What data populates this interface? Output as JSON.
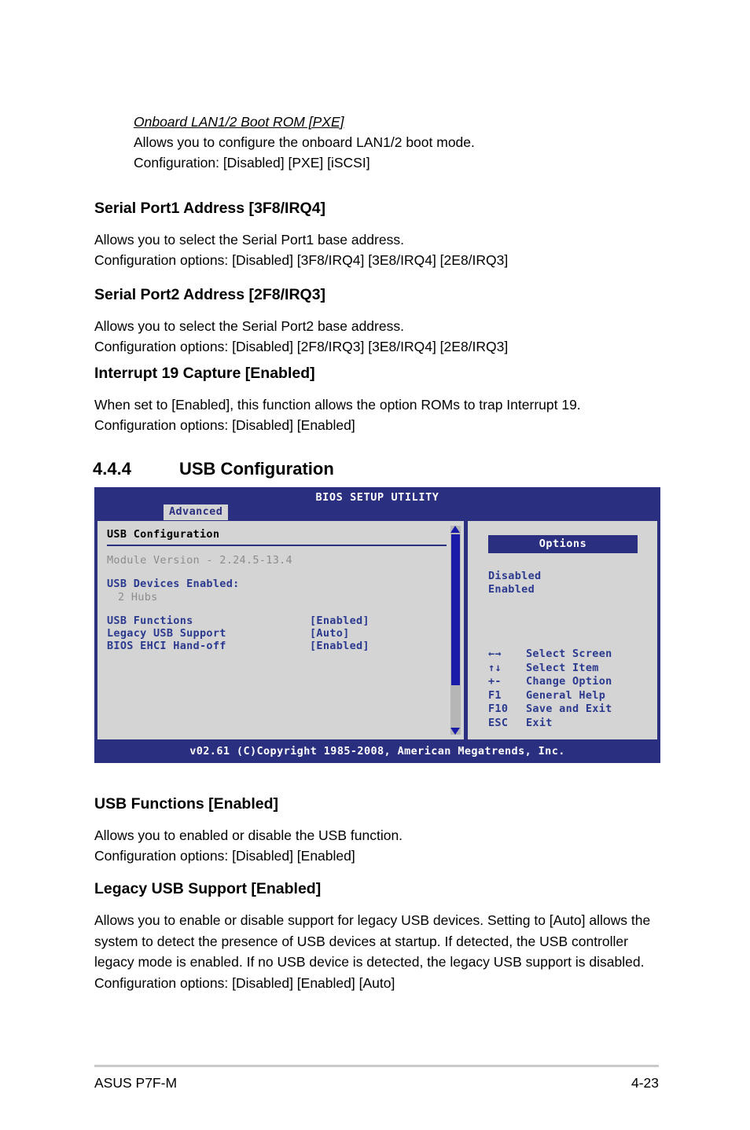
{
  "colors": {
    "bios_blue": "#2b2f80",
    "bios_panel_gray": "#d4d4d4",
    "bios_text_blue": "#2b3a8f",
    "bios_dim_gray": "#8c8c8c",
    "scrollbar_blue": "#1a1aa8"
  },
  "sections": {
    "onboard_lan": {
      "heading": "Onboard LAN1/2 Boot ROM [PXE]",
      "line1": "Allows you to configure the onboard LAN1/2 boot mode.",
      "line2": "Configuration: [Disabled] [PXE] [iSCSI]"
    },
    "serial_port1": {
      "heading": "Serial Port1 Address [3F8/IRQ4]",
      "line1": "Allows you to select the Serial Port1 base address.",
      "line2": "Configuration options: [Disabled] [3F8/IRQ4] [3E8/IRQ4] [2E8/IRQ3]"
    },
    "serial_port2": {
      "heading": "Serial Port2 Address [2F8/IRQ3]",
      "line1": "Allows you to select the Serial Port2 base address.",
      "line2": "Configuration options: [Disabled] [2F8/IRQ3] [3E8/IRQ4] [2E8/IRQ3]"
    },
    "interrupt19": {
      "heading": "Interrupt 19 Capture [Enabled]",
      "line1": "When set to [Enabled], this function allows the option ROMs to trap Interrupt 19.",
      "line2": "Configuration options: [Disabled] [Enabled]"
    },
    "usb_functions": {
      "heading": "USB Functions [Enabled]",
      "line1": "Allows you to enabled or disable the USB function.",
      "line2": "Configuration options: [Disabled] [Enabled]"
    },
    "legacy_usb": {
      "heading": "Legacy USB Support [Enabled]",
      "paragraph": "Allows you to enable or disable support for legacy USB devices. Setting to [Auto] allows the system to detect the presence of USB devices at startup. If detected, the USB controller legacy mode is enabled. If no USB device is detected, the legacy USB support is disabled. Configuration options: [Disabled] [Enabled] [Auto]"
    }
  },
  "section_heading": {
    "number": "4.4.4",
    "title": "USB Configuration"
  },
  "bios": {
    "title": "BIOS SETUP UTILITY",
    "tab": "Advanced",
    "panel_title": "USB Configuration",
    "module_version": "Module Version - 2.24.5-13.4",
    "devices_label": "USB Devices Enabled:",
    "devices_value": "2 Hubs",
    "settings": [
      {
        "label": "USB Functions",
        "value": "[Enabled]"
      },
      {
        "label": "Legacy USB Support",
        "value": "[Auto]"
      },
      {
        "label": "BIOS EHCI Hand-off",
        "value": "[Enabled]"
      }
    ],
    "options_header": "Options",
    "options": [
      "Disabled",
      "Enabled"
    ],
    "legend": [
      {
        "key": "←→",
        "desc": "Select Screen"
      },
      {
        "key": "↑↓",
        "desc": "Select Item"
      },
      {
        "key": "+-",
        "desc": "Change Option"
      },
      {
        "key": "F1",
        "desc": "General Help"
      },
      {
        "key": "F10",
        "desc": "Save and Exit"
      },
      {
        "key": "ESC",
        "desc": "Exit"
      }
    ],
    "footer": "v02.61 (C)Copyright 1985-2008, American Megatrends, Inc."
  },
  "page_footer": {
    "left": "ASUS P7F-M",
    "right": "4-23"
  }
}
